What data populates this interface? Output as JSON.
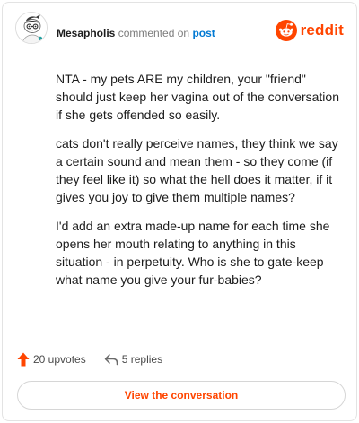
{
  "header": {
    "author": "Mesapholis",
    "action_text": "commented on",
    "post_link": "post",
    "brand_word": "reddit"
  },
  "comment": {
    "paragraphs": [
      "NTA - my pets ARE my children, your \"friend\" should just keep her vagina out of the conversation if she gets offended so easily.",
      "cats don't really perceive names, they think we say a certain sound and mean them - so they come (if they feel like it) so what the hell does it matter, if it gives you joy to give them multiple names?",
      "I'd add an extra made-up name for each time she opens her mouth relating to anything in this situation - in perpetuity. Who is she to gate-keep what name you give your fur-babies?"
    ]
  },
  "actions": {
    "upvotes": "20 upvotes",
    "replies": "5 replies"
  },
  "cta": {
    "label": "View the conversation"
  },
  "icons": {
    "avatar": "snoo-avatar-icon",
    "brand": "reddit-logo-icon",
    "upvote": "upvote-arrow-icon",
    "reply": "reply-arrow-icon"
  },
  "colors": {
    "brand": "#ff4500",
    "link": "#0079d3",
    "text": "#1c1c1c",
    "muted": "#7c7c7c"
  }
}
